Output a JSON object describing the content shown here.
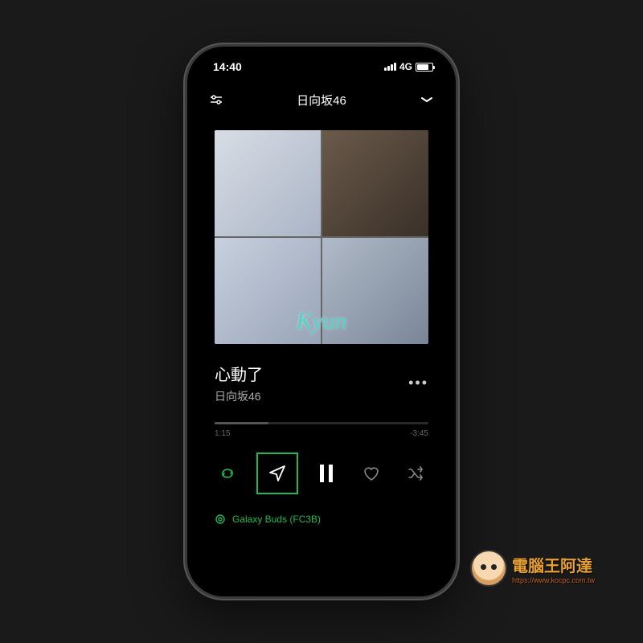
{
  "status": {
    "time": "14:40",
    "network": "4G"
  },
  "nav": {
    "title": "日向坂46"
  },
  "album": {
    "logo_text": "Kyun"
  },
  "track": {
    "title": "心動了",
    "artist": "日向坂46"
  },
  "progress": {
    "elapsed": "1:15",
    "remaining": "-3:45",
    "percent": 25
  },
  "device": {
    "name": "Galaxy Buds (FC3B)"
  },
  "watermark": {
    "title": "電腦王阿達",
    "url": "https://www.kocpc.com.tw"
  },
  "accent_color": "#1db954"
}
